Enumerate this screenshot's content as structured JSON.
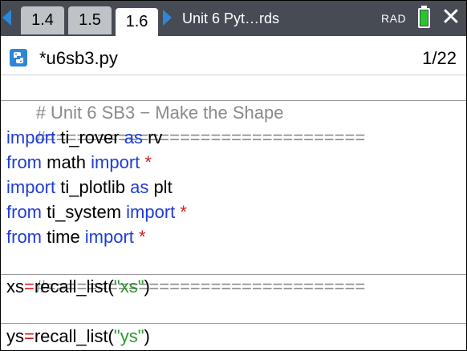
{
  "tabs": [
    {
      "label": "1.4",
      "active": false
    },
    {
      "label": "1.5",
      "active": false
    },
    {
      "label": "1.6",
      "active": true
    }
  ],
  "doc_title": "Unit 6 Pyt…rds",
  "mode": "RAD",
  "file": {
    "name": "*u6sb3.py",
    "page": "1/22"
  },
  "code": {
    "l1": "# Unit 6 SB3 − Make the Shape",
    "l2": "#===============================",
    "l3_kw1": "import",
    "l3_mid": " ti_rover ",
    "l3_kw2": "as",
    "l3_end": " rv",
    "l4_kw1": "from",
    "l4_mid": " math ",
    "l4_kw2": "import",
    "l4_star": " *",
    "l5_kw1": "import",
    "l5_mid": " ti_plotlib ",
    "l5_kw2": "as",
    "l5_end": " plt",
    "l6_kw1": "from",
    "l6_mid": " ti_system ",
    "l6_kw2": "import",
    "l6_star": " *",
    "l7_kw1": "from",
    "l7_mid": " time ",
    "l7_kw2": "import",
    "l7_star": " *",
    "l8": "#===============================",
    "l9_var": "xs",
    "l9_op": "=",
    "l9_fn": "recall_list(",
    "l9_str": "\"xs\"",
    "l9_end": ")",
    "l11_var": "ys",
    "l11_op": "=",
    "l11_fn": "recall_list(",
    "l11_str": "\"ys\"",
    "l11_end": ")"
  },
  "colors": {
    "tabbar": "#464b54",
    "arrows": "#2f86d6",
    "keyword": "#1f3cd6",
    "operator": "#d81b1b",
    "string": "#2a9a2a",
    "comment": "#8a8a8a",
    "battery": "#28c828"
  }
}
